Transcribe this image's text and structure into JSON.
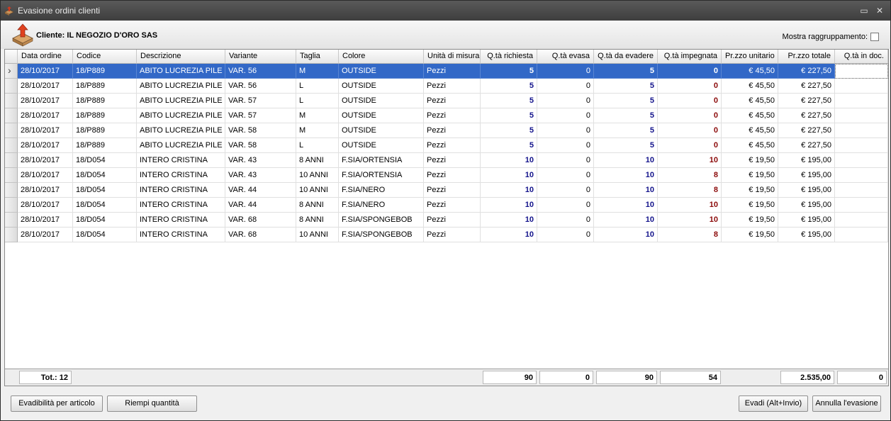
{
  "window": {
    "title": "Evasione ordini clienti",
    "minimize_glyph": "▭",
    "close_glyph": "✕"
  },
  "client": {
    "label": "Cliente: IL NEGOZIO D'ORO SAS"
  },
  "grouping": {
    "label": "Mostra raggruppamento:",
    "checked": false
  },
  "columns": [
    "Data ordine",
    "Codice",
    "Descrizione",
    "Variante",
    "Taglia",
    "Colore",
    "Unità di misura",
    "Q.tà richiesta",
    "Q.tà evasa",
    "Q.tà da evadere",
    "Q.tà impegnata",
    "Pr.zzo unitario",
    "Pr.zzo totale",
    "Q.tà in doc."
  ],
  "rows": [
    {
      "date": "28/10/2017",
      "code": "18/P889",
      "desc": "ABITO LUCREZIA PILE",
      "variant": "VAR. 56",
      "size": "M",
      "color": "OUTSIDE",
      "uom": "Pezzi",
      "requested": "5",
      "shipped": "0",
      "to_ship": "5",
      "committed": "0",
      "unit_price": "€ 45,50",
      "total": "€ 227,50",
      "in_doc": ""
    },
    {
      "date": "28/10/2017",
      "code": "18/P889",
      "desc": "ABITO LUCREZIA PILE",
      "variant": "VAR. 56",
      "size": "L",
      "color": "OUTSIDE",
      "uom": "Pezzi",
      "requested": "5",
      "shipped": "0",
      "to_ship": "5",
      "committed": "0",
      "unit_price": "€ 45,50",
      "total": "€ 227,50",
      "in_doc": ""
    },
    {
      "date": "28/10/2017",
      "code": "18/P889",
      "desc": "ABITO LUCREZIA PILE",
      "variant": "VAR. 57",
      "size": "L",
      "color": "OUTSIDE",
      "uom": "Pezzi",
      "requested": "5",
      "shipped": "0",
      "to_ship": "5",
      "committed": "0",
      "unit_price": "€ 45,50",
      "total": "€ 227,50",
      "in_doc": ""
    },
    {
      "date": "28/10/2017",
      "code": "18/P889",
      "desc": "ABITO LUCREZIA PILE",
      "variant": "VAR. 57",
      "size": "M",
      "color": "OUTSIDE",
      "uom": "Pezzi",
      "requested": "5",
      "shipped": "0",
      "to_ship": "5",
      "committed": "0",
      "unit_price": "€ 45,50",
      "total": "€ 227,50",
      "in_doc": ""
    },
    {
      "date": "28/10/2017",
      "code": "18/P889",
      "desc": "ABITO LUCREZIA PILE",
      "variant": "VAR. 58",
      "size": "M",
      "color": "OUTSIDE",
      "uom": "Pezzi",
      "requested": "5",
      "shipped": "0",
      "to_ship": "5",
      "committed": "0",
      "unit_price": "€ 45,50",
      "total": "€ 227,50",
      "in_doc": ""
    },
    {
      "date": "28/10/2017",
      "code": "18/P889",
      "desc": "ABITO LUCREZIA PILE",
      "variant": "VAR. 58",
      "size": "L",
      "color": "OUTSIDE",
      "uom": "Pezzi",
      "requested": "5",
      "shipped": "0",
      "to_ship": "5",
      "committed": "0",
      "unit_price": "€ 45,50",
      "total": "€ 227,50",
      "in_doc": ""
    },
    {
      "date": "28/10/2017",
      "code": "18/D054",
      "desc": "INTERO CRISTINA",
      "variant": "VAR. 43",
      "size": "8 ANNI",
      "color": "F.SIA/ORTENSIA",
      "uom": "Pezzi",
      "requested": "10",
      "shipped": "0",
      "to_ship": "10",
      "committed": "10",
      "unit_price": "€ 19,50",
      "total": "€ 195,00",
      "in_doc": ""
    },
    {
      "date": "28/10/2017",
      "code": "18/D054",
      "desc": "INTERO CRISTINA",
      "variant": "VAR. 43",
      "size": "10 ANNI",
      "color": "F.SIA/ORTENSIA",
      "uom": "Pezzi",
      "requested": "10",
      "shipped": "0",
      "to_ship": "10",
      "committed": "8",
      "unit_price": "€ 19,50",
      "total": "€ 195,00",
      "in_doc": ""
    },
    {
      "date": "28/10/2017",
      "code": "18/D054",
      "desc": "INTERO CRISTINA",
      "variant": "VAR. 44",
      "size": "10 ANNI",
      "color": "F.SIA/NERO",
      "uom": "Pezzi",
      "requested": "10",
      "shipped": "0",
      "to_ship": "10",
      "committed": "8",
      "unit_price": "€ 19,50",
      "total": "€ 195,00",
      "in_doc": ""
    },
    {
      "date": "28/10/2017",
      "code": "18/D054",
      "desc": "INTERO CRISTINA",
      "variant": "VAR. 44",
      "size": "8 ANNI",
      "color": "F.SIA/NERO",
      "uom": "Pezzi",
      "requested": "10",
      "shipped": "0",
      "to_ship": "10",
      "committed": "10",
      "unit_price": "€ 19,50",
      "total": "€ 195,00",
      "in_doc": ""
    },
    {
      "date": "28/10/2017",
      "code": "18/D054",
      "desc": "INTERO CRISTINA",
      "variant": "VAR. 68",
      "size": "8 ANNI",
      "color": "F.SIA/SPONGEBOB",
      "uom": "Pezzi",
      "requested": "10",
      "shipped": "0",
      "to_ship": "10",
      "committed": "10",
      "unit_price": "€ 19,50",
      "total": "€ 195,00",
      "in_doc": ""
    },
    {
      "date": "28/10/2017",
      "code": "18/D054",
      "desc": "INTERO CRISTINA",
      "variant": "VAR. 68",
      "size": "10 ANNI",
      "color": "F.SIA/SPONGEBOB",
      "uom": "Pezzi",
      "requested": "10",
      "shipped": "0",
      "to_ship": "10",
      "committed": "8",
      "unit_price": "€ 19,50",
      "total": "€ 195,00",
      "in_doc": ""
    }
  ],
  "selected_row": 0,
  "totals": {
    "count_label": "Tot.: 12",
    "requested": "90",
    "shipped": "0",
    "to_ship": "90",
    "committed": "54",
    "total": "2.535,00",
    "in_doc": "0"
  },
  "buttons": {
    "evadibility": "Evadibilità per articolo",
    "fill_qty": "Riempi quantità",
    "ship": "Evadi (Alt+Invio)",
    "cancel": "Annulla l'evasione"
  },
  "colors": {
    "selection": "#3268c7",
    "qty_blue": "#14148c",
    "qty_red": "#8b0a0a"
  },
  "icons": {
    "app": "box-arrow-icon",
    "client": "box-arrow-icon"
  }
}
